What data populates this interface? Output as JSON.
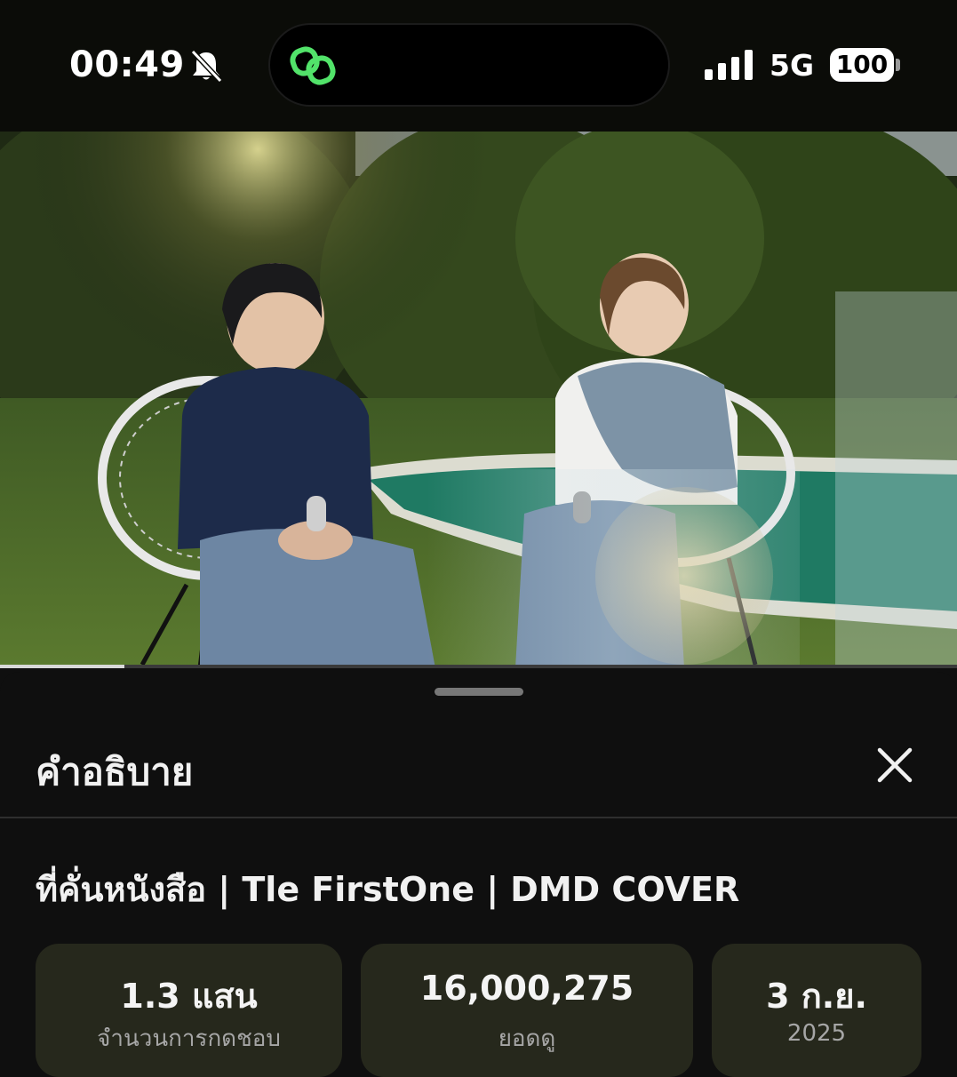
{
  "status_bar": {
    "time": "00:49",
    "network": "5G",
    "battery": "100",
    "mute_icon": "bell-slash-icon",
    "island_icon": "link-icon"
  },
  "video": {
    "progress_fraction": 0.13
  },
  "sheet": {
    "title": "คำอธิบาย",
    "close_icon": "close-icon",
    "video_title": "ที่คั่นหนังสือ | Tle FirstOne | DMD COVER",
    "stats": [
      {
        "value": "1.3 แสน",
        "label": "จำนวนการกดชอบ"
      },
      {
        "value": "16,000,275",
        "label": "ยอดดู"
      },
      {
        "value": "3 ก.ย.",
        "label": "2025"
      }
    ]
  },
  "colors": {
    "background": "#0f0f0f",
    "card": "#26281c",
    "accent_green": "#52e36a"
  }
}
